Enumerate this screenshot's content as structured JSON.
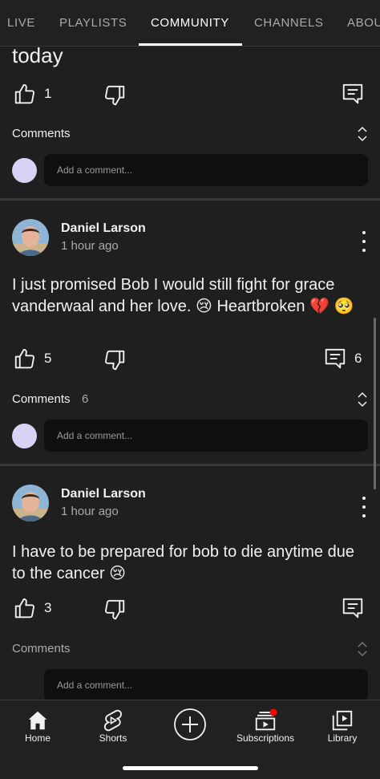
{
  "tabs": [
    {
      "label": "LIVE"
    },
    {
      "label": "PLAYLISTS"
    },
    {
      "label": "COMMUNITY"
    },
    {
      "label": "CHANNELS"
    },
    {
      "label": "ABOU"
    }
  ],
  "active_tab": "COMMUNITY",
  "posts": [
    {
      "text_tail": "today",
      "likes": "1",
      "comments_label": "Comments",
      "comment_placeholder": "Add a comment..."
    },
    {
      "author": "Daniel Larson",
      "time": "1 hour ago",
      "text": "I just promised Bob I would still fight for grace vanderwaal and her love. 😢 Heartbroken 💔 🥺",
      "likes": "5",
      "reply_count": "6",
      "comments_label": "Comments",
      "comments_count": "6",
      "comment_placeholder": "Add a comment..."
    },
    {
      "author": "Daniel Larson",
      "time": "1 hour ago",
      "text": "I have to be prepared for bob to die anytime due to the cancer 😢",
      "likes": "3",
      "comments_label": "Comments",
      "comment_placeholder": "Add a comment..."
    }
  ],
  "bottom_nav": [
    {
      "label": "Home",
      "icon": "home-icon"
    },
    {
      "label": "Shorts",
      "icon": "shorts-icon"
    },
    {
      "label": "",
      "icon": "create-icon"
    },
    {
      "label": "Subscriptions",
      "icon": "subscriptions-icon"
    },
    {
      "label": "Library",
      "icon": "library-icon"
    }
  ],
  "colors": {
    "background": "#1f1f1f",
    "comment_box": "#0f0f0f",
    "avatar_placeholder": "#d9d2f5",
    "notification_dot": "#ff0000"
  }
}
